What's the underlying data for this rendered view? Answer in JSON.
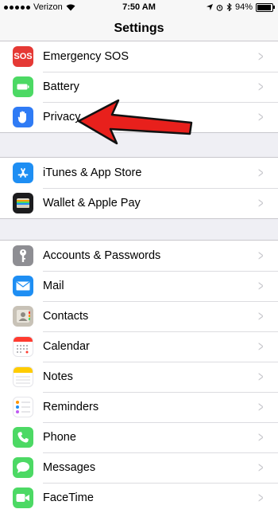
{
  "status_bar": {
    "carrier": "Verizon",
    "time": "7:50 AM",
    "battery": "94%",
    "battery_level": 0.94
  },
  "nav": {
    "title": "Settings"
  },
  "groups": [
    {
      "items": [
        {
          "label": "Emergency SOS",
          "icon": "sos-icon",
          "color": "#e53935",
          "icon_text": "SOS"
        },
        {
          "label": "Battery",
          "icon": "battery-icon",
          "color": "#4cd964"
        },
        {
          "label": "Privacy",
          "icon": "hand-icon",
          "color": "#2f7bf5"
        }
      ]
    },
    {
      "items": [
        {
          "label": "iTunes & App Store",
          "icon": "app-store-icon",
          "color": "#1e8ef3"
        },
        {
          "label": "Wallet & Apple Pay",
          "icon": "wallet-icon",
          "color": "#1c1c1e"
        }
      ]
    },
    {
      "items": [
        {
          "label": "Accounts & Passwords",
          "icon": "key-icon",
          "color": "#8e8e93"
        },
        {
          "label": "Mail",
          "icon": "mail-icon",
          "color": "#1e8ef3"
        },
        {
          "label": "Contacts",
          "icon": "contacts-icon",
          "color": "#c8c2b7"
        },
        {
          "label": "Calendar",
          "icon": "calendar-icon",
          "color": "#ffffff"
        },
        {
          "label": "Notes",
          "icon": "notes-icon",
          "color": "#ffffff"
        },
        {
          "label": "Reminders",
          "icon": "reminders-icon",
          "color": "#ffffff"
        },
        {
          "label": "Phone",
          "icon": "phone-icon",
          "color": "#4cd964"
        },
        {
          "label": "Messages",
          "icon": "messages-icon",
          "color": "#4cd964"
        },
        {
          "label": "FaceTime",
          "icon": "facetime-icon",
          "color": "#4cd964"
        }
      ]
    }
  ]
}
